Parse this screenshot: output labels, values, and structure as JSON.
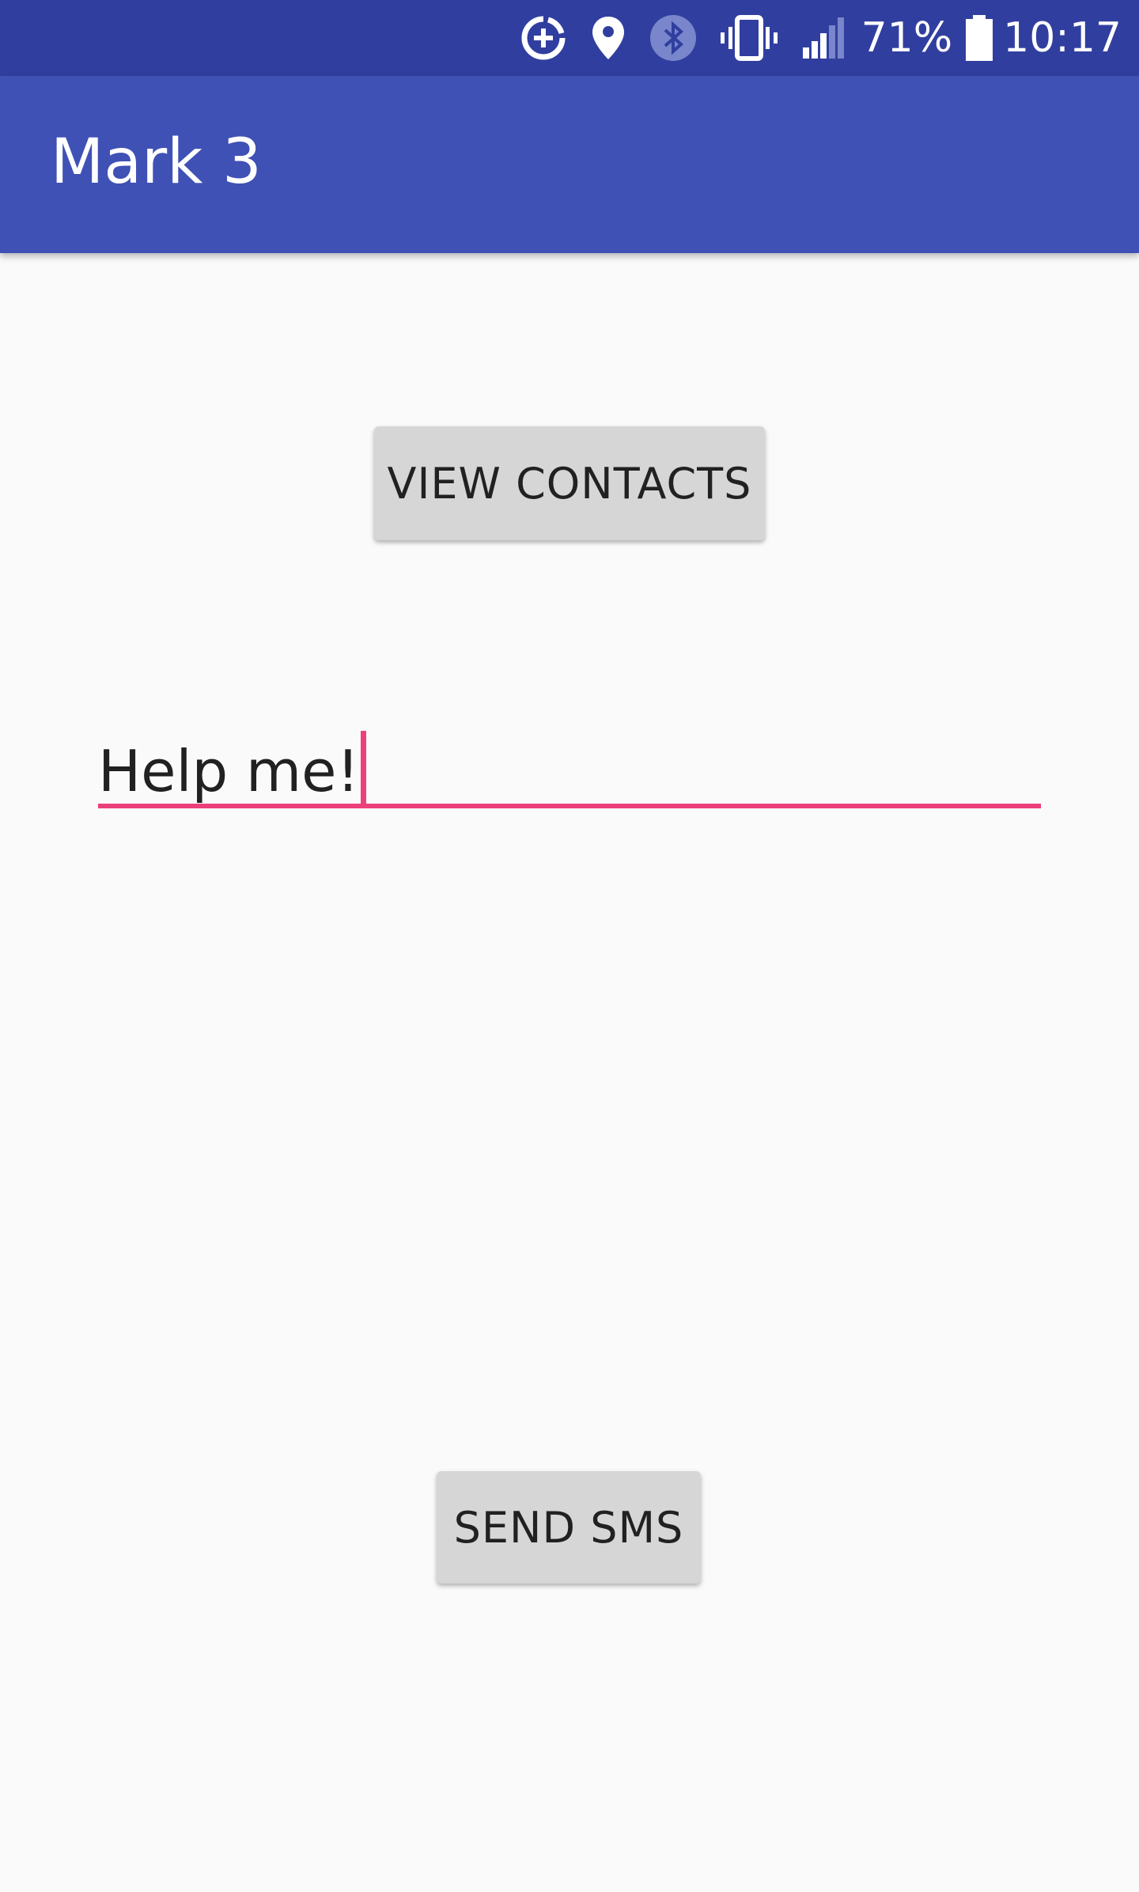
{
  "status_bar": {
    "icons": [
      "data-saver-icon",
      "location-icon",
      "bluetooth-icon",
      "vibrate-icon",
      "signal-icon",
      "battery-icon"
    ],
    "battery_percent": "71%",
    "time": "10:17",
    "background": "#303f9f"
  },
  "app_bar": {
    "title": "Mark 3",
    "background": "#3f51b5"
  },
  "main": {
    "view_contacts_label": "VIEW CONTACTS",
    "message_value": "Help me!",
    "send_sms_label": "SEND SMS",
    "accent_color": "#ec407a"
  }
}
